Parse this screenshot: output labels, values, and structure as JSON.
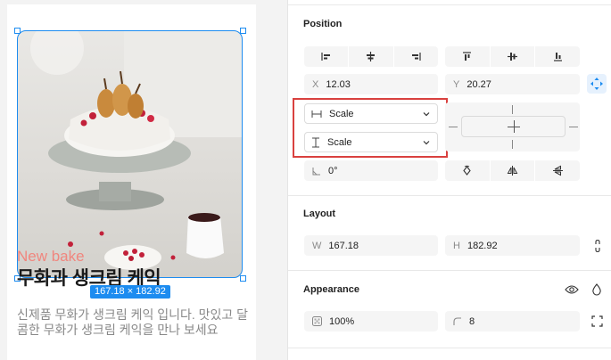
{
  "canvas": {
    "subtitle": "New bake",
    "title": "무화과 생크림 케익",
    "dimension_badge": "167.18 × 182.92",
    "description": "신제품 무화가 생크림 케익 입니다. 맛있고 달콤한 무화가 생크림 케익을 만나 보세요"
  },
  "position": {
    "section_title": "Position",
    "x_label": "X",
    "x_value": "12.03",
    "y_label": "Y",
    "y_value": "20.27",
    "horizontal_constraint": "Scale",
    "vertical_constraint": "Scale",
    "rotation_value": "0°"
  },
  "layout": {
    "section_title": "Layout",
    "w_label": "W",
    "w_value": "167.18",
    "h_label": "H",
    "h_value": "182.92"
  },
  "appearance": {
    "section_title": "Appearance",
    "opacity_value": "100%",
    "radius_value": "8"
  },
  "colors": {
    "selection": "#1d8cf0",
    "highlight": "#d9413f",
    "subtitle": "#f0867e"
  }
}
